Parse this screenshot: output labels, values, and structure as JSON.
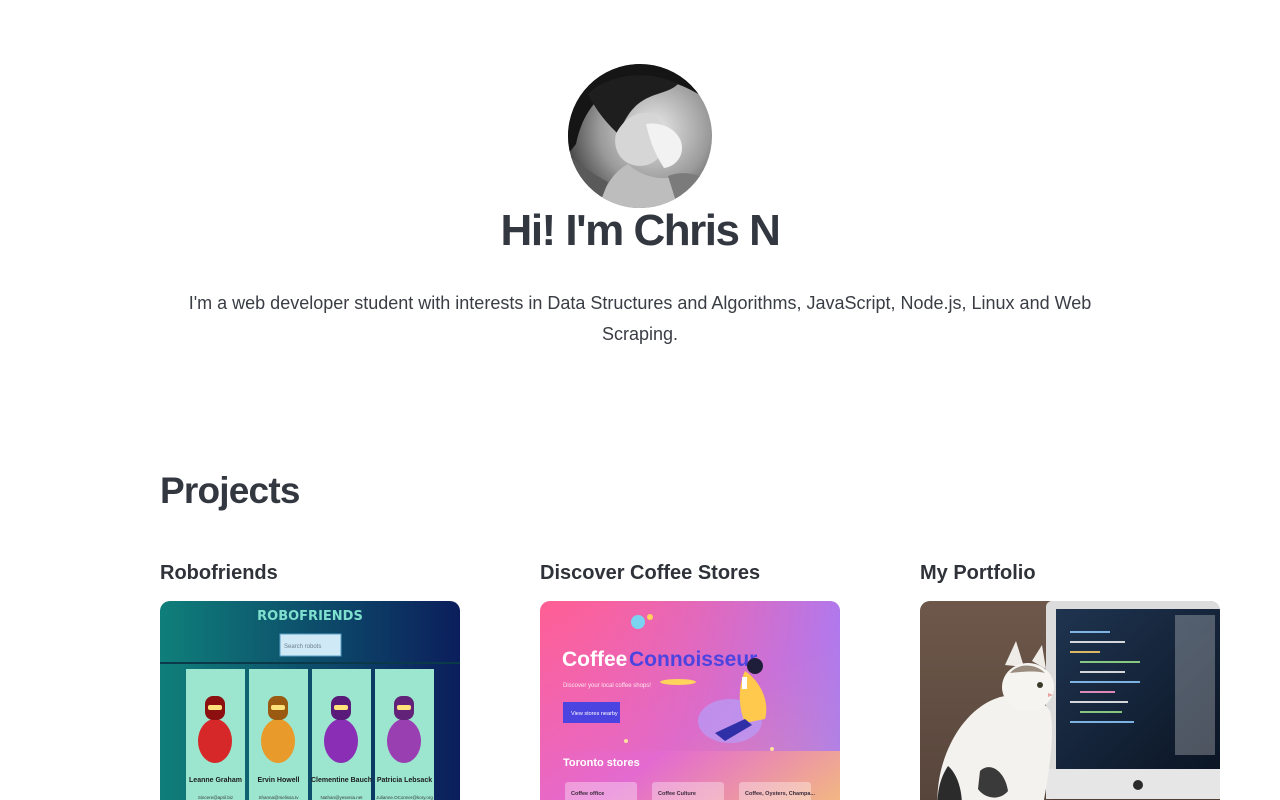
{
  "hero": {
    "title": "Hi! I'm Chris N",
    "bio": "I'm a web developer student with interests in Data Structures and Algorithms, JavaScript, Node.js, Linux and Web Scraping."
  },
  "projects": {
    "heading": "Projects",
    "items": [
      {
        "title": "Robofriends",
        "screenshot": {
          "app_title": "ROBOFRIENDS",
          "search_placeholder": "Search robots",
          "robots": [
            {
              "name": "Leanne Graham",
              "email": "Sincere@april.biz"
            },
            {
              "name": "Ervin Howell",
              "email": "Shanna@melissa.tv"
            },
            {
              "name": "Clementine Bauch",
              "email": "Nathan@yesenia.net"
            },
            {
              "name": "Patricia Lebsack",
              "email": "Julianne.OConner@kory.org"
            }
          ]
        }
      },
      {
        "title": "Discover Coffee Stores",
        "screenshot": {
          "brand_part1": "Coffee",
          "brand_part2": "Connoisseur",
          "tagline": "Discover your local coffee shops!",
          "button_label": "View stores nearby",
          "section": "Toronto stores",
          "stores": [
            "Coffee office",
            "Coffee Culture",
            "Coffee, Oysters, Champa..."
          ]
        }
      },
      {
        "title": "My Portfolio",
        "screenshot": {}
      }
    ]
  },
  "colors": {
    "text": "#333740",
    "robo_bg_start": "#0f7f7a",
    "robo_bg_end": "#0b1e5c",
    "robo_card": "#9ce6cf",
    "coffee_start": "#ff5f93",
    "coffee_end": "#a77bf2",
    "coffee_accent": "#4c44e0"
  }
}
